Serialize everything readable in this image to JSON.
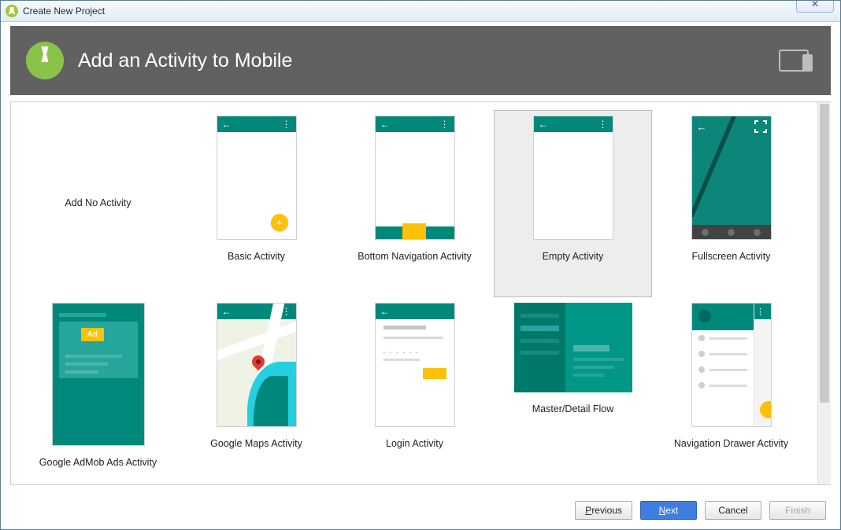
{
  "window": {
    "title": "Create New Project"
  },
  "banner": {
    "title": "Add an Activity to Mobile"
  },
  "activities": [
    {
      "label": "Add No Activity",
      "kind": "none"
    },
    {
      "label": "Basic Activity",
      "kind": "basic"
    },
    {
      "label": "Bottom Navigation Activity",
      "kind": "bottomnav"
    },
    {
      "label": "Empty Activity",
      "kind": "empty",
      "selected": true
    },
    {
      "label": "Fullscreen Activity",
      "kind": "fullscreen"
    },
    {
      "label": "Google AdMob Ads Activity",
      "kind": "admob"
    },
    {
      "label": "Google Maps Activity",
      "kind": "maps"
    },
    {
      "label": "Login Activity",
      "kind": "login"
    },
    {
      "label": "Master/Detail Flow",
      "kind": "masterdetail"
    },
    {
      "label": "Navigation Drawer Activity",
      "kind": "navdrawer"
    }
  ],
  "buttons": {
    "previous": "Previous",
    "next": "Next",
    "cancel": "Cancel",
    "finish": "Finish"
  },
  "admob_text": "Ad"
}
